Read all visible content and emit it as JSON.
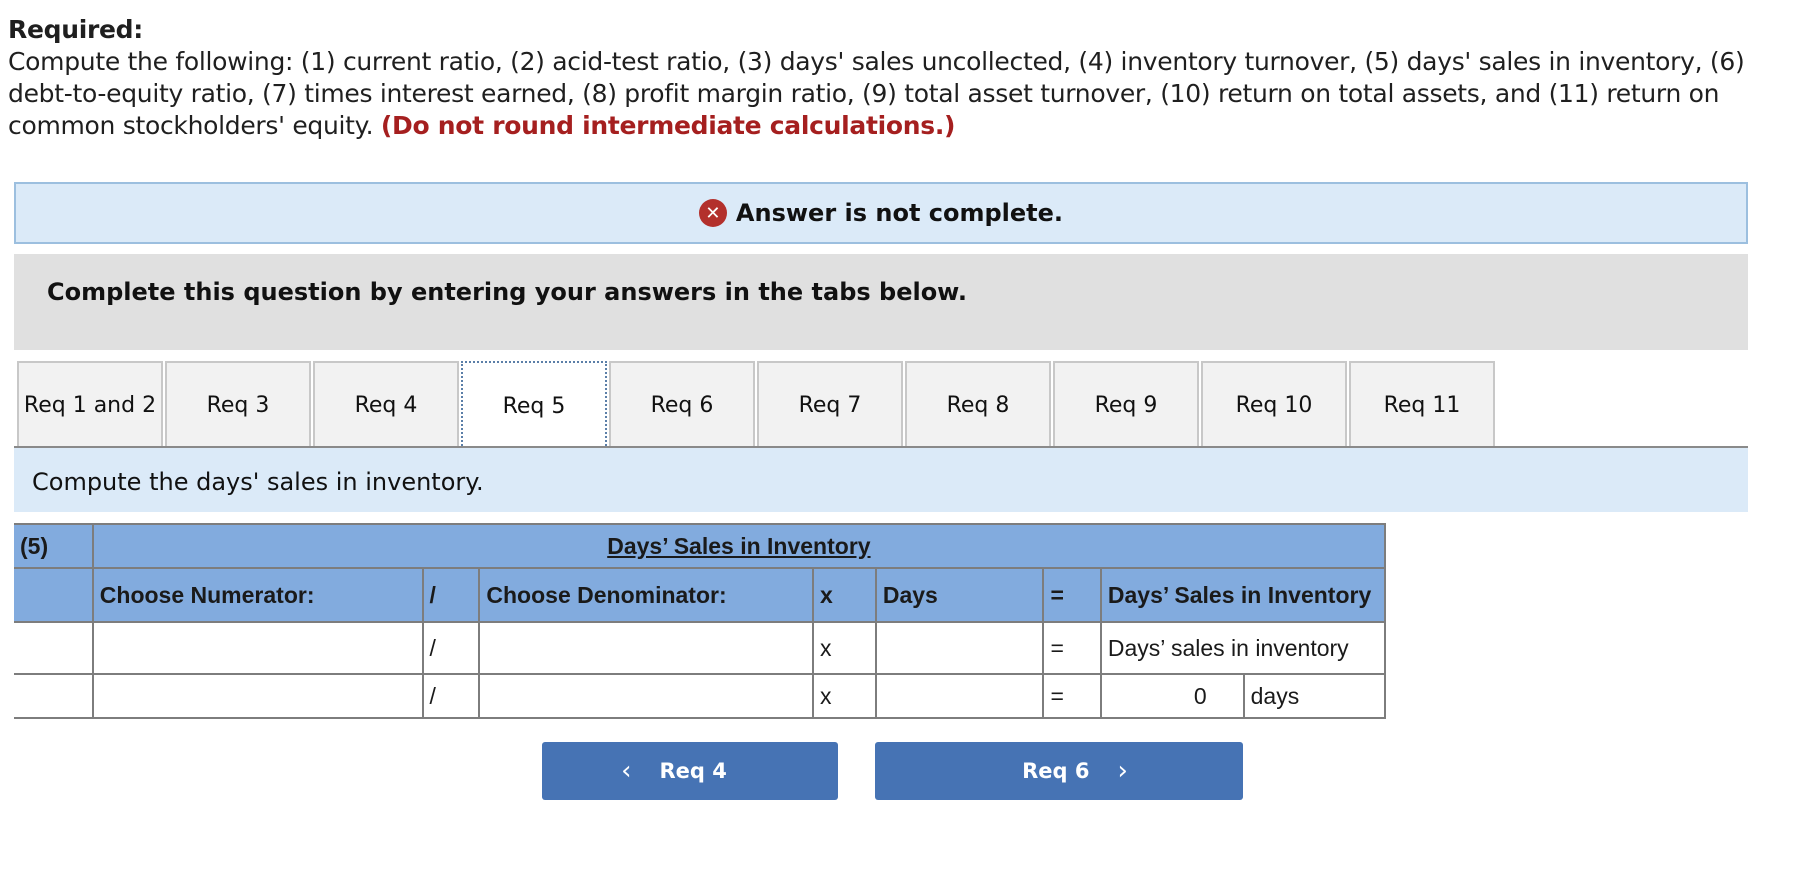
{
  "required": {
    "title": "Required:",
    "body": "Compute the following: (1) current ratio, (2) acid-test ratio, (3) days' sales uncollected, (4) inventory turnover, (5) days' sales in inventory, (6) debt-to-equity ratio, (7) times interest earned, (8) profit margin ratio, (9) total asset turnover, (10) return on total assets, and (11) return on common stockholders' equity. ",
    "warning": "(Do not round intermediate calculations.)"
  },
  "status": {
    "icon": "x-circle-icon",
    "text": "Answer is not complete.",
    "color": "#b3302c"
  },
  "instruction": "Complete this question by entering your answers in the tabs below.",
  "tabs": [
    {
      "label": "Req 1 and 2",
      "active": false
    },
    {
      "label": "Req 3",
      "active": false
    },
    {
      "label": "Req 4",
      "active": false
    },
    {
      "label": "Req 5",
      "active": true
    },
    {
      "label": "Req 6",
      "active": false
    },
    {
      "label": "Req 7",
      "active": false
    },
    {
      "label": "Req 8",
      "active": false
    },
    {
      "label": "Req 9",
      "active": false
    },
    {
      "label": "Req 10",
      "active": false
    },
    {
      "label": "Req 11",
      "active": false
    }
  ],
  "tab_description": "Compute the days' sales in inventory.",
  "table": {
    "part_label": "(5)",
    "title": "Days’ Sales in Inventory",
    "headers": {
      "numerator": "Choose Numerator:",
      "divide": "/",
      "denominator": "Choose Denominator:",
      "multiply": "x",
      "days": "Days",
      "equals": "=",
      "result": "Days’ Sales in Inventory"
    },
    "rows": [
      {
        "numerator": "",
        "divide": "/",
        "denominator": "",
        "multiply": "x",
        "days": "",
        "equals": "=",
        "result": "Days’ sales in inventory",
        "unit": ""
      },
      {
        "numerator": "",
        "divide": "/",
        "denominator": "",
        "multiply": "x",
        "days": "",
        "equals": "=",
        "result": "0",
        "unit": "days"
      }
    ]
  },
  "navigation": {
    "prev_label": "Req 4",
    "next_label": "Req 6",
    "prev_icon": "chevron-left-icon",
    "next_icon": "chevron-right-icon",
    "button_color": "#4673b4"
  }
}
